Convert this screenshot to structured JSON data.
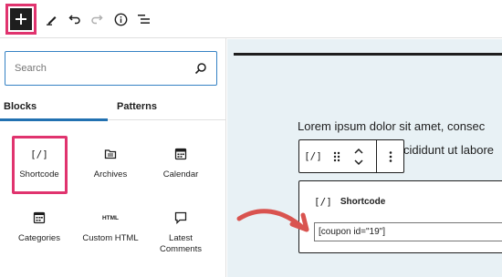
{
  "toolbar": {
    "items": [
      "add-block",
      "edit",
      "undo",
      "redo",
      "details",
      "list-view"
    ]
  },
  "sidebar": {
    "search": {
      "placeholder": "Search",
      "value": ""
    },
    "tabs": [
      {
        "label": "Blocks",
        "active": true
      },
      {
        "label": "Patterns",
        "active": false
      }
    ],
    "blocks": [
      {
        "label": "Shortcode",
        "icon": "shortcode-icon",
        "glyph": "[/]",
        "highlighted": true
      },
      {
        "label": "Archives",
        "icon": "archive-folder-icon"
      },
      {
        "label": "Calendar",
        "icon": "calendar-icon"
      },
      {
        "label": "Categories",
        "icon": "categories-icon"
      },
      {
        "label": "Custom HTML",
        "icon": "html-icon",
        "glyph": "HTML"
      },
      {
        "label": "Latest Comments",
        "icon": "comment-icon"
      }
    ]
  },
  "editor": {
    "paragraph_line1": "Lorem ipsum dolor sit amet, consec",
    "paragraph_line2": "cididunt ut labore",
    "block_toolbar": {
      "block_glyph": "[/]",
      "items": [
        "shortcode-icon",
        "drag-handle-icon",
        "move-up-down-icon",
        "more-options-icon"
      ]
    },
    "shortcode_block": {
      "glyph": "[/]",
      "title": "Shortcode",
      "value": "[coupon id=\"19\"]"
    }
  },
  "colors": {
    "highlight": "#e0336e",
    "accent": "#2271b1",
    "canvas_bg": "#e8f1f5",
    "arrow": "#d9534f"
  }
}
